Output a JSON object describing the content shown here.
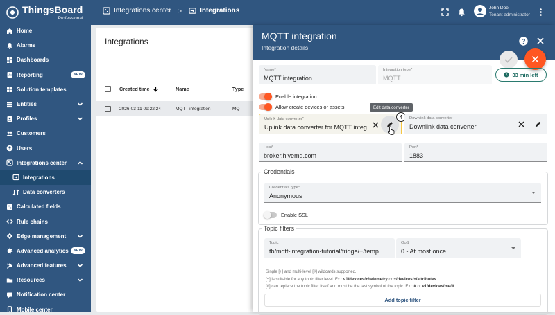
{
  "logo": {
    "name": "ThingsBoard",
    "edition": "Professional"
  },
  "sidebar": {
    "items": [
      {
        "label": "Home",
        "icon": "home-icon"
      },
      {
        "label": "Alarms",
        "icon": "alarm-icon"
      },
      {
        "label": "Dashboards",
        "icon": "dashboard-icon"
      },
      {
        "label": "Reporting",
        "icon": "reporting-icon",
        "badge": "NEW"
      },
      {
        "label": "Solution templates",
        "icon": "solution-templates-icon"
      },
      {
        "label": "Entities",
        "icon": "entities-icon",
        "expandable": true
      },
      {
        "label": "Profiles",
        "icon": "profiles-icon",
        "expandable": true
      },
      {
        "label": "Customers",
        "icon": "customers-icon"
      },
      {
        "label": "Users",
        "icon": "users-icon"
      },
      {
        "label": "Integrations center",
        "icon": "integrations-center-icon",
        "expanded": true
      },
      {
        "label": "Integrations",
        "icon": "integrations-icon",
        "active": true,
        "sub": true
      },
      {
        "label": "Data converters",
        "icon": "data-converters-icon",
        "sub": true
      },
      {
        "label": "Calculated fields",
        "icon": "calculated-fields-icon"
      },
      {
        "label": "Rule chains",
        "icon": "rule-chains-icon"
      },
      {
        "label": "Edge management",
        "icon": "edge-management-icon",
        "expandable": true
      },
      {
        "label": "Advanced analytics",
        "icon": "analytics-icon",
        "badge": "NEW"
      },
      {
        "label": "Advanced features",
        "icon": "advanced-features-icon",
        "expandable": true
      },
      {
        "label": "Resources",
        "icon": "resources-icon",
        "expandable": true
      },
      {
        "label": "Notification center",
        "icon": "notification-center-icon"
      },
      {
        "label": "Mobile center",
        "icon": "mobile-center-icon"
      }
    ]
  },
  "topbar": {
    "breadcrumb": [
      "Integrations center",
      "Integrations"
    ],
    "separator": ">",
    "user_name": "John Doe",
    "user_role": "Tenant administrator"
  },
  "main": {
    "title": "Integrations",
    "columns": [
      "Created time",
      "Name",
      "Type"
    ],
    "rows": [
      {
        "created": "2026-03-11 09:22:24",
        "name": "MQTT integration",
        "type": "MQTT"
      }
    ]
  },
  "panel": {
    "title": "MQTT integration",
    "subtitle": "Integration details",
    "timer": "33 min left",
    "name_label": "Name*",
    "name_value": "MQTT integration",
    "type_label": "Integration type*",
    "type_value": "MQTT",
    "enable_label": "Enable integration",
    "allow_label": "Allow create devices or assets",
    "tooltip": "Edit data converter",
    "step_badge": "4",
    "uplink_label": "Uplink data converter*",
    "uplink_value": "Uplink data converter for MQTT integ",
    "downlink_label": "Downlink data converter",
    "downlink_value": "Downlink data converter",
    "host_label": "Host*",
    "host_value": "broker.hivemq.com",
    "port_label": "Port*",
    "port_value": "1883",
    "credentials_legend": "Credentials",
    "cred_type_label": "Credentials type*",
    "cred_type_value": "Anonymous",
    "ssl_label": "Enable SSL",
    "topic_legend": "Topic filters",
    "topic_label": "Topic",
    "topic_value": "tb/mqtt-integration-tutorial/fridge/+/temp",
    "qos_label": "QoS",
    "qos_value": "0 - At most once",
    "hint1": "Single [+] and multi-level [#] wildcards supported.",
    "hint2_a": "[+] is suitable for any topic filter level. Ex.: ",
    "hint2_b": "v1/devices/+/telemetry",
    "hint2_c": " or ",
    "hint2_d": "+/devices/+/attributes",
    "hint2_e": ".",
    "hint3_a": "[#] can replace the topic filter itself and must be the last symbol of the topic. Ex.: ",
    "hint3_b": "#",
    "hint3_c": " or ",
    "hint3_d": "v1/devices/me/#",
    "hint3_e": ".",
    "add_topic": "Add topic filter"
  },
  "colors": {
    "primary": "#305680",
    "accent": "#ff5722",
    "timer": "#1d6b61",
    "focus": "#f6c744"
  }
}
